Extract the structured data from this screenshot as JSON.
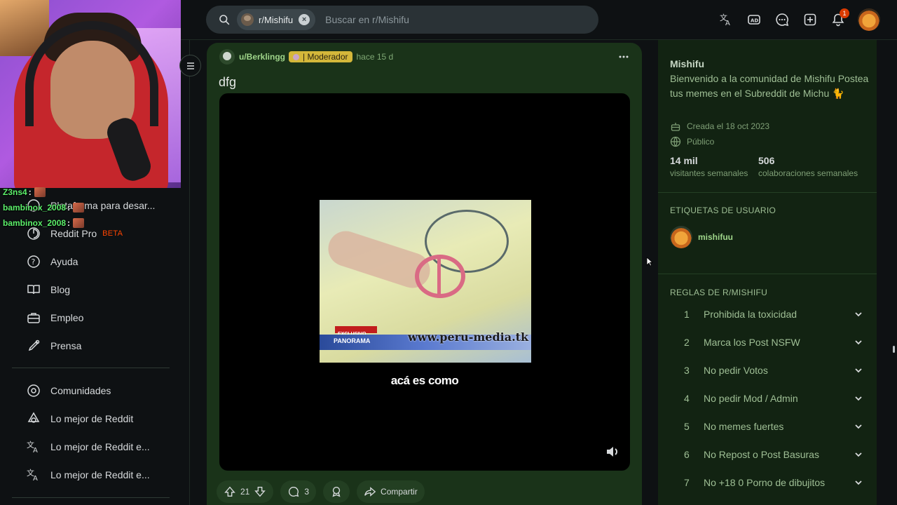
{
  "header": {
    "search_chip": "r/Mishifu",
    "search_placeholder": "Buscar en r/Mishifu",
    "notification_count": "1"
  },
  "sidebar": {
    "items": [
      {
        "label": "Plataforma para desar...",
        "icon": "code-icon"
      },
      {
        "label": "Reddit Pro",
        "badge": "BETA",
        "icon": "pro-icon"
      },
      {
        "label": "Ayuda",
        "icon": "help-icon"
      },
      {
        "label": "Blog",
        "icon": "book-icon"
      },
      {
        "label": "Empleo",
        "icon": "briefcase-icon"
      },
      {
        "label": "Prensa",
        "icon": "press-icon"
      }
    ],
    "items2": [
      {
        "label": "Comunidades",
        "icon": "communities-icon"
      },
      {
        "label": "Lo mejor de Reddit",
        "icon": "best-icon"
      },
      {
        "label": "Lo mejor de Reddit e...",
        "icon": "translate-icon"
      },
      {
        "label": "Lo mejor de Reddit e...",
        "icon": "translate-icon"
      }
    ]
  },
  "chat": [
    {
      "user": "Z3ns4",
      "sep": ":"
    },
    {
      "user": "bambinox_2008",
      "sep": ":"
    },
    {
      "user": "bambinox_2008",
      "sep": ":"
    }
  ],
  "post": {
    "author": "u/Berklingg",
    "flair": "| Moderador",
    "time": "hace 15 d",
    "title": "dfg",
    "video_watermark": "www.peru-media.tk",
    "video_band_text": "PANORAMA",
    "video_tag": "EXCLUSIVO",
    "subtitle": "acá es como",
    "upvotes": "21",
    "comments": "3",
    "share_label": "Compartir"
  },
  "community": {
    "name": "Mishifu",
    "description": "Bienvenido a la comunidad de Mishifu Postea tus memes en el Subreddit de Michu 🐈",
    "created": "Creada el 18 oct 2023",
    "visibility": "Público",
    "stats": [
      {
        "value": "14 mil",
        "label": "visitantes semanales"
      },
      {
        "value": "506",
        "label": "colaboraciones semanales"
      }
    ],
    "user_tags_heading": "ETIQUETAS DE USUARIO",
    "user_tag": "mishifuu",
    "rules_heading": "REGLAS DE R/MISHIFU",
    "rules": [
      {
        "n": "1",
        "text": "Prohibida la toxicidad"
      },
      {
        "n": "2",
        "text": "Marca los Post NSFW"
      },
      {
        "n": "3",
        "text": "No pedir Votos"
      },
      {
        "n": "4",
        "text": "No pedir Mod / Admin"
      },
      {
        "n": "5",
        "text": "No memes fuertes"
      },
      {
        "n": "6",
        "text": "No Repost o Post Basuras"
      },
      {
        "n": "7",
        "text": "No +18 0 Porno de dibujitos"
      }
    ]
  },
  "colors": {
    "post_bg": "#1a3319",
    "sidebar_bg": "#122312",
    "username": "#9fd58a",
    "mod_flair": "#d4b73a",
    "beta": "#ff4500",
    "chat_user": "#5cf06b"
  }
}
